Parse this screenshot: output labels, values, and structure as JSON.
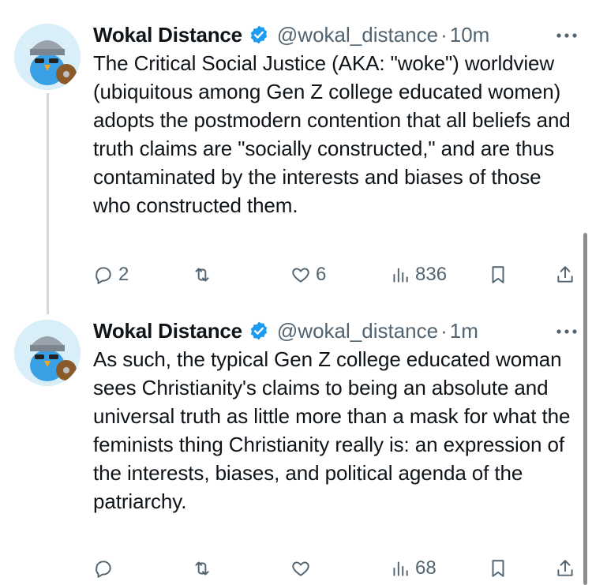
{
  "tweets": [
    {
      "author": {
        "name": "Wokal Distance",
        "handle": "@wokal_distance",
        "verified": true
      },
      "separator": "·",
      "time": "10m",
      "text": "The Critical Social Justice (AKA: \"woke\") worldview (ubiquitous among Gen Z college educated women) adopts the postmodern contention that all beliefs and truth claims are \"socially constructed,\" and are thus contaminated by the interests and biases of those who constructed them.",
      "actions": {
        "replies": "2",
        "retweets": "",
        "likes": "6",
        "views": "836"
      }
    },
    {
      "author": {
        "name": "Wokal Distance",
        "handle": "@wokal_distance",
        "verified": true
      },
      "separator": "·",
      "time": "1m",
      "text": "As such, the typical Gen Z college educated woman sees Christianity's claims to being an absolute and universal truth as little more than a mask for what the feminists thing Christianity really is: an expression of the interests, biases, and political agenda of the patriarchy.",
      "actions": {
        "replies": "",
        "retweets": "",
        "likes": "",
        "views": "68"
      }
    }
  ],
  "icons": {
    "reply": "reply-icon",
    "retweet": "retweet-icon",
    "like": "heart-icon",
    "views": "views-icon",
    "bookmark": "bookmark-icon",
    "share": "share-icon",
    "more": "more-icon",
    "verified": "verified-badge-icon"
  },
  "colors": {
    "text": "#0f1419",
    "secondary": "#536471",
    "verified": "#1d9bf0",
    "thread_line": "#cfd9de"
  }
}
